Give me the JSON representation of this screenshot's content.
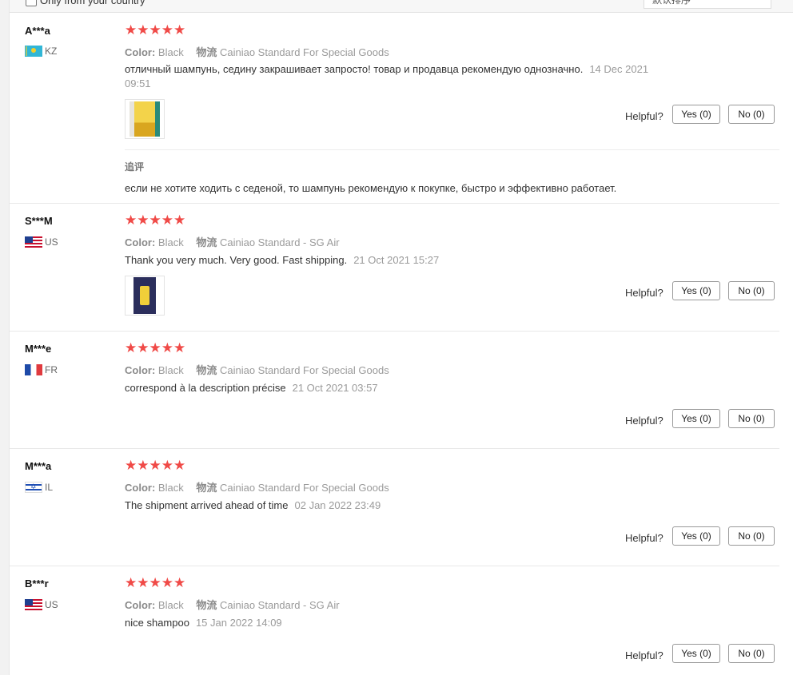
{
  "filter": {
    "label": "Only from your country"
  },
  "sort": {
    "value": "默认排序"
  },
  "helpful_label": "Helpful?",
  "labels": {
    "color": "Color:",
    "logistics": "物流",
    "followup": "追评"
  },
  "reviews": [
    {
      "user": "A***a",
      "country": "KZ",
      "rating": "★★★★★",
      "color": "Black",
      "shipping": "Cainiao Standard For Special Goods",
      "text": "отличный шампунь, седину закрашивает запросто! товар и продавца рекомендую однозначно.",
      "date_part1": "14 Dec 2021",
      "date_part2": "09:51",
      "yes": "Yes (0)",
      "no": "No (0)",
      "followup": "если не хотите ходить с седеной, то шампунь рекомендую к покупке, быстро и эффективно работает."
    },
    {
      "user": "S***M",
      "country": "US",
      "rating": "★★★★★",
      "color": "Black",
      "shipping": "Cainiao Standard - SG Air",
      "text": "Thank you very much. Very good. Fast shipping.",
      "date": "21 Oct 2021 15:27",
      "yes": "Yes (0)",
      "no": "No (0)"
    },
    {
      "user": "M***e",
      "country": "FR",
      "rating": "★★★★★",
      "color": "Black",
      "shipping": "Cainiao Standard For Special Goods",
      "text": "correspond à la description précise",
      "date": "21 Oct 2021 03:57",
      "yes": "Yes (0)",
      "no": "No (0)"
    },
    {
      "user": "M***a",
      "country": "IL",
      "rating": "★★★★★",
      "color": "Black",
      "shipping": "Cainiao Standard For Special Goods",
      "text": "The shipment arrived ahead of time",
      "date": "02 Jan 2022 23:49",
      "yes": "Yes (0)",
      "no": "No (0)"
    },
    {
      "user": "B***r",
      "country": "US",
      "rating": "★★★★★",
      "color": "Black",
      "shipping": "Cainiao Standard - SG Air",
      "text": "nice shampoo",
      "date": "15 Jan 2022 14:09",
      "yes": "Yes (0)",
      "no": "No (0)"
    }
  ]
}
